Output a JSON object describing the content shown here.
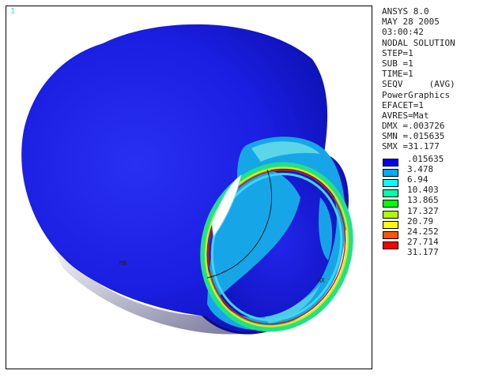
{
  "window": {
    "number": "1"
  },
  "info_lines": [
    "ANSYS 8.0",
    "MAY 28 2005",
    "03:00:42",
    "NODAL SOLUTION",
    "STEP=1",
    "SUB =1",
    "TIME=1",
    "SEQV     (AVG)",
    "PowerGraphics",
    "EFACET=1",
    "AVRES=Mat",
    "DMX =.003726",
    "SMN =.015635",
    "SMX =31.177"
  ],
  "legend": [
    {
      "value": ".015635",
      "color": "#0000ff"
    },
    {
      "value": "3.478",
      "color": "#00aaff"
    },
    {
      "value": "6.94",
      "color": "#00ffff"
    },
    {
      "value": "10.403",
      "color": "#00ffaa"
    },
    {
      "value": "13.865",
      "color": "#00ff00"
    },
    {
      "value": "17.327",
      "color": "#aaff00"
    },
    {
      "value": "20.79",
      "color": "#ffff00"
    },
    {
      "value": "24.252",
      "color": "#ffaa00"
    },
    {
      "value": "27.714",
      "color": "#ff5500"
    },
    {
      "value": "31.177",
      "color": "#ff0000"
    }
  ],
  "markers": {
    "min": "MN",
    "max": "MX"
  },
  "colors": {
    "body_blue": "#1a1ee0",
    "body_dark": "#06088a",
    "hole": "#ffffff",
    "frame": "#000000"
  }
}
